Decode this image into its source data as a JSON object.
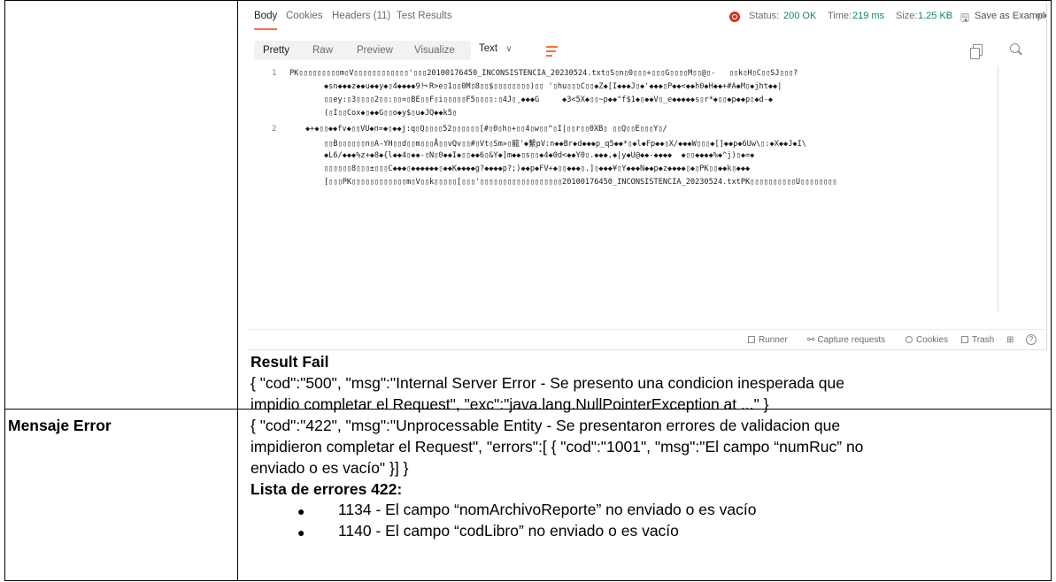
{
  "postman": {
    "tabs": [
      {
        "label": "Body"
      },
      {
        "label": "Cookies"
      },
      {
        "label": "Headers (11)"
      },
      {
        "label": "Test Results"
      }
    ],
    "status_label": "Status:",
    "status_value": "200 OK",
    "time_label": "Time:",
    "time_value": "219 ms",
    "size_label": "Size:",
    "size_value": "1.25 KB",
    "save_example": "Save as Example",
    "more": "ooo",
    "view_modes": [
      "Pretty",
      "Raw",
      "Preview",
      "Visualize"
    ],
    "format": "Text",
    "format_chevron": "∨",
    "code": {
      "line1_no": "1",
      "line2_no": "2",
      "l1": "PK▯▯▯▯▯▯▯▯▯m▯V▯▯▯▯▯▯▯▯▯▯▯▯'▯▯▯20100176450_INCONSISTENCIA_20230524.txt▯S▯n▯0▯▯▯+▯▯▯G▯▯▯▯M▯▯@▯-   ▯▯k▯H▯C▯▯SJ▯▯▯?",
      "l1b": "◆sn◆◆◆z◆◆u◆◆y◆▯4◆◆◆◆9!˞R>e▯1▯▯0M▯8▯▯$▯▯▯▯▯▯▯▯)▯▯ '▯hu▯▯▯C▯▯◆Ž◆[I◆◆◆J▯◆'◆◆◆▯P◆◆<◆◆h0◆H◆◆+#A◆M▯◆jht◆◆|",
      "l1c": "▯▯ey:▯3▯▯▯▯2▯▯:▯▯=▯BE▯▯F▯i▯▯▯▯▯F5▯▯▯▯:▯4J▯¸◆◆◆G     ◆3<5X◆▯▯~p◆◆\"f$1◆▯◆◆V▯_e◆◆◆◆◆s▯r*◆▯▯◆p◆◆p▯◆d-◆",
      "l1d": "(▯I▯▯Cox◆▯◆◆G▯▯o◆y$▯u◆JQ◆◆k5▯",
      "l2": "◆+◆▯▯◆◆fv◆▯▯VU◆п=◆▯◆◆j:q▯Q▯▯▯▯52▯▯▯▯▯▯[#▯0▯h▯+▯▯4▯w▯▯^▯I|▯▯r▯▯0XB▯ ▯▯Q▯▯E▯▯▯Y▯/",
      "l2b": "▯▯B▯▯▯▯▯▯n▯A-YH▯▯d▯▯m▯▯▯Å▯▯vQv▯▯#▯Vt▯Sm»▯龍'◆繫pV:n◆◆Br◆d◆◆◆p_q5◆◆*▯◆l◆Fp◆◆▯X/◆◆◆W▯▯▯◆[]◆◆p◆6Uw\\▯:◆X◆◆J◆I\\",
      "l2c": "◆L6/◆◆◆%z+◆8◆{l◆◆4▯◆◆-▯N▯0◆◆I◆▯▯◆◆6▯&Y◆]m◆◆▯s▯▯◆4◆0d<◆◆Y0▯.◆◆◆,◆|y◆U@◆◆-◆◆◆◆  ◆▯▯◆◆◆◆%◆^j)▯◆=◆",
      "l2d": "▯▯▯▯▯▯8▯▯▯±▯▯▯C◆◆◆▯◆◆◆◆◆◆▯◆◆K◆◆◆◆g?◆◆◆◆p?;)◆◆p◆FV+◆▯▯◆◆◆▯.]▯◆◆◆¥▯Y◆◆◆N◆◆p◆z◆◆◆◆▯◆▯PK▯▯◆◆k▯◆◆◆",
      "l2e": "[▯▯▯PK▯▯▯▯▯▯▯▯▯▯▯▯m▯V▯▯k▯▯▯▯▯[▯▯▯'▯▯▯▯▯▯▯▯▯▯▯▯▯▯▯▯▯▯20100176450_INCONSISTENCIA_20230524.txtPK▯▯▯▯▯▯▯▯▯▯U▯▯▯▯▯▯▯▯"
    },
    "footer": {
      "runner": "Runner",
      "capture": "Capture requests",
      "cookies": "Cookies",
      "trash": "Trash",
      "help": "?"
    }
  },
  "doc": {
    "result_fail_title": "Result Fail",
    "result_fail_line1": "{ \"cod\":\"500\", \"msg\":\"Internal Server Error - Se presento una condicion inesperada que",
    "result_fail_line2": "impidio completar el Request\", \"exc\":\"java.lang.NullPointerException at ...\" }",
    "mensaje_error_label": "Mensaje Error",
    "error_line1": "{ \"cod\":\"422\", \"msg\":\"Unprocessable Entity - Se presentaron errores de validacion que",
    "error_line2": "impidieron completar el Request\", \"errors\":[ { \"cod\":\"1001\", \"msg\":\"El campo “numRuc” no",
    "error_line3": "enviado o es vacío\" }] }",
    "list_title": "Lista de errores 422:",
    "bullet": "●",
    "list_items": [
      "1134 - El campo “nomArchivoReporte” no enviado o es vacío",
      "1140 - El campo “codLibro” no enviado o es vacío"
    ]
  },
  "colors": {
    "accent": "#ff6c37",
    "status_ok": "#0f8a4f",
    "line_number": "#5a86a5"
  }
}
